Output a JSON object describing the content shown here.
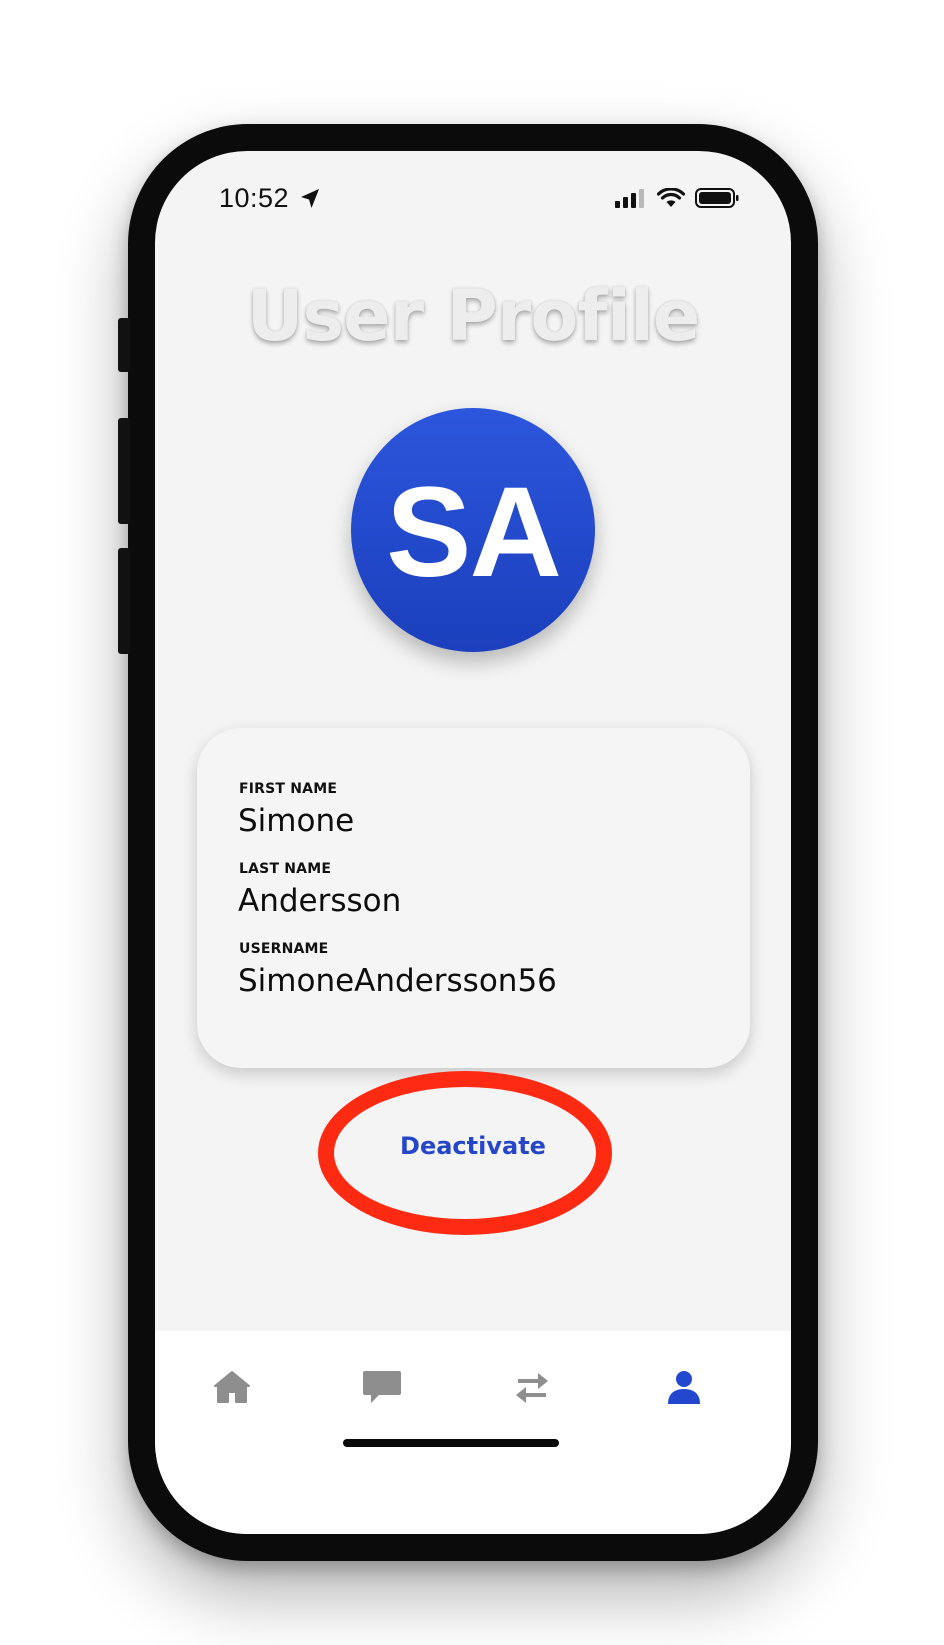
{
  "status_bar": {
    "time": "10:52",
    "icons": [
      "location-arrow-icon",
      "cellular-signal-icon",
      "wifi-icon",
      "battery-icon"
    ]
  },
  "header": {
    "title": "User Profile"
  },
  "avatar": {
    "initials": "SA",
    "color": "#2447d0"
  },
  "profile": {
    "fields": [
      {
        "label": "FIRST NAME",
        "value": "Simone"
      },
      {
        "label": "LAST NAME",
        "value": "Andersson"
      },
      {
        "label": "USERNAME",
        "value": "SimoneAndersson56"
      }
    ]
  },
  "actions": {
    "deactivate_label": "Deactivate",
    "deactivate_color": "#2546c8",
    "highlight_color": "#ff2a12"
  },
  "tab_bar": {
    "tabs": [
      {
        "icon": "home-icon",
        "active": false
      },
      {
        "icon": "chat-bubble-icon",
        "active": false
      },
      {
        "icon": "transfer-arrows-icon",
        "active": false
      },
      {
        "icon": "user-profile-icon",
        "active": true
      }
    ],
    "active_color": "#2447d0",
    "inactive_color": "#8e8e8e"
  }
}
